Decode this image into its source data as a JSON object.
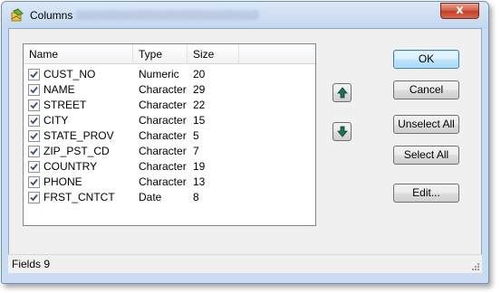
{
  "window": {
    "title": "Columns",
    "close_label": "x"
  },
  "list": {
    "headers": [
      "Name",
      "Type",
      "Size"
    ],
    "rows": [
      {
        "checked": true,
        "name": "CUST_NO",
        "type": "Numeric",
        "size": "20"
      },
      {
        "checked": true,
        "name": "NAME",
        "type": "Character",
        "size": "29"
      },
      {
        "checked": true,
        "name": "STREET",
        "type": "Character",
        "size": "22"
      },
      {
        "checked": true,
        "name": "CITY",
        "type": "Character",
        "size": "15"
      },
      {
        "checked": true,
        "name": "STATE_PROV",
        "type": "Character",
        "size": "5"
      },
      {
        "checked": true,
        "name": "ZIP_PST_CD",
        "type": "Character",
        "size": "7"
      },
      {
        "checked": true,
        "name": "COUNTRY",
        "type": "Character",
        "size": "19"
      },
      {
        "checked": true,
        "name": "PHONE",
        "type": "Character",
        "size": "13"
      },
      {
        "checked": true,
        "name": "FRST_CNTCT",
        "type": "Date",
        "size": "8"
      }
    ]
  },
  "buttons": {
    "ok": "OK",
    "cancel": "Cancel",
    "unselect_all": "Unselect All",
    "select_all": "Select All",
    "edit": "Edit..."
  },
  "status": {
    "text": "Fields 9"
  },
  "colors": {
    "accent": "#3c7fb1",
    "arrow": "#1f6f5c",
    "titlebar": "#c9dcf2"
  }
}
